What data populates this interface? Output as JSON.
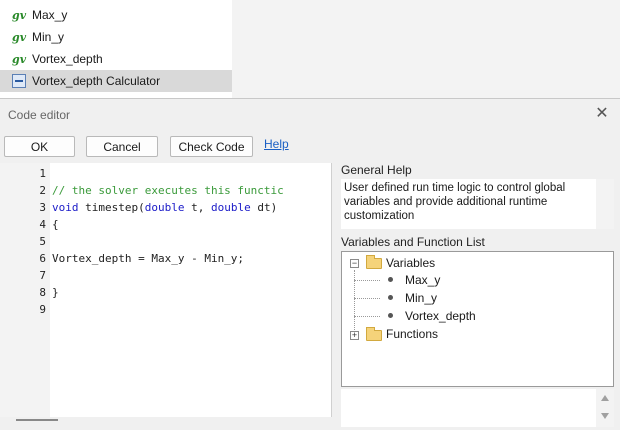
{
  "top_tree": {
    "items": [
      {
        "icon": "gv",
        "label": "Max_y"
      },
      {
        "icon": "gv",
        "label": "Min_y"
      },
      {
        "icon": "gv",
        "label": "Vortex_depth"
      },
      {
        "icon": "calculator",
        "label": "Vortex_depth Calculator",
        "selected": true
      }
    ]
  },
  "dialog": {
    "title": "Code editor",
    "buttons": {
      "ok": "OK",
      "cancel": "Cancel",
      "check": "Check Code"
    },
    "help_link": "Help"
  },
  "editor": {
    "line_numbers": [
      "1",
      "2",
      "3",
      "4",
      "5",
      "6",
      "7",
      "8",
      "9"
    ],
    "lines": [
      "",
      "// the solver executes this functic",
      "void timestep(double t, double dt)",
      "{",
      "",
      "Vortex_depth = Max_y - Min_y;",
      "",
      "}",
      ""
    ]
  },
  "general_help": {
    "header": "General Help",
    "text": "User defined run time logic to control global variables and provide additional runtime customization"
  },
  "var_list": {
    "header": "Variables and Function List",
    "variables_label": "Variables",
    "variables": [
      "Max_y",
      "Min_y",
      "Vortex_depth"
    ],
    "functions_label": "Functions"
  },
  "colors": {
    "accent_link": "#1a5fc4",
    "comment": "#3a9a3a",
    "keyword": "#1b1bc8",
    "gv_icon": "#2a8a2a"
  }
}
